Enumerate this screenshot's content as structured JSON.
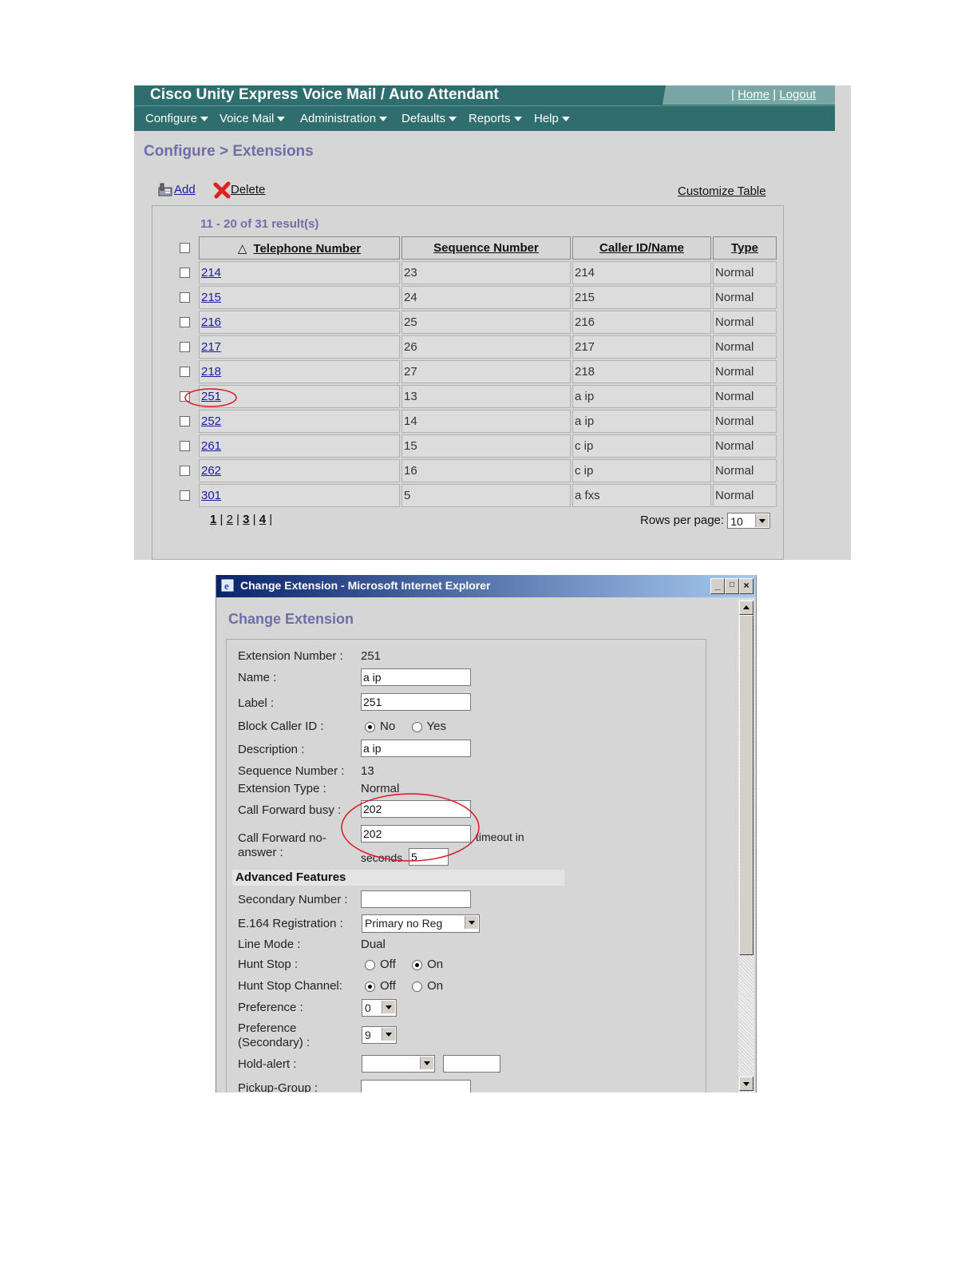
{
  "header": {
    "title": "Cisco Unity Express Voice Mail / Auto Attendant",
    "home": "Home",
    "logout": "Logout",
    "colors": {
      "bar": "#2f6e6e",
      "accent": "#7aa6a6",
      "heading": "#6e6ea8",
      "annotation": "#e0141e"
    }
  },
  "menu": [
    "Configure",
    "Voice Mail",
    "Administration",
    "Defaults",
    "Reports",
    "Help"
  ],
  "breadcrumb": "Configure > Extensions",
  "toolbar": {
    "add": "Add",
    "delete": "Delete",
    "customize": "Customize Table"
  },
  "results": "11 - 20 of 31 result(s)",
  "table": {
    "sort_indicator": "△",
    "columns": [
      "Telephone Number",
      "Sequence Number",
      "Caller ID/Name",
      "Type"
    ],
    "rows": [
      [
        "214",
        "23",
        "214",
        "Normal"
      ],
      [
        "215",
        "24",
        "215",
        "Normal"
      ],
      [
        "216",
        "25",
        "216",
        "Normal"
      ],
      [
        "217",
        "26",
        "217",
        "Normal"
      ],
      [
        "218",
        "27",
        "218",
        "Normal"
      ],
      [
        "251",
        "13",
        "a ip",
        "Normal"
      ],
      [
        "252",
        "14",
        "a ip",
        "Normal"
      ],
      [
        "261",
        "15",
        "c ip",
        "Normal"
      ],
      [
        "262",
        "16",
        "c ip",
        "Normal"
      ],
      [
        "301",
        "5",
        "a fxs",
        "Normal"
      ]
    ],
    "highlighted_row": 5
  },
  "pager": {
    "current": "1",
    "pages": [
      "2",
      "3",
      "4"
    ]
  },
  "rows_per_page": {
    "label": "Rows per page:",
    "value": "10"
  },
  "dialog": {
    "window_title": "Change Extension - Microsoft Internet Explorer",
    "heading": "Change Extension",
    "fields": {
      "extension_number": {
        "label": "Extension Number :",
        "value": "251"
      },
      "name": {
        "label": "Name :",
        "value": "a ip"
      },
      "label": {
        "label": "Label :",
        "value": "251"
      },
      "block_caller_id": {
        "label": "Block Caller ID :",
        "no": "No",
        "yes": "Yes",
        "selected": "No"
      },
      "description": {
        "label": "Description :",
        "value": "a ip"
      },
      "sequence_number": {
        "label": "Sequence Number :",
        "value": "13"
      },
      "extension_type": {
        "label": "Extension Type :",
        "value": "Normal"
      },
      "cfwd_busy": {
        "label": "Call Forward busy :",
        "value": "202"
      },
      "cfwd_noanswer": {
        "label1": "Call Forward no-",
        "label2": "answer :",
        "value": "202",
        "timeout_label": "timeout in",
        "seconds_label": "seconds",
        "seconds_value": "5"
      }
    },
    "advanced_heading": "Advanced Features",
    "advanced": {
      "secondary_number": {
        "label": "Secondary Number :",
        "value": ""
      },
      "e164": {
        "label": "E.164 Registration :",
        "value": "Primary no Reg"
      },
      "line_mode": {
        "label": "Line Mode :",
        "value": "Dual"
      },
      "hunt_stop": {
        "label": "Hunt Stop :",
        "off": "Off",
        "on": "On",
        "selected": "On"
      },
      "hunt_stop_channel": {
        "label": "Hunt Stop Channel:",
        "off": "Off",
        "on": "On",
        "selected": "Off"
      },
      "preference": {
        "label": "Preference :",
        "value": "0"
      },
      "preference_secondary": {
        "label1": "Preference",
        "label2": "(Secondary) :",
        "value": "9"
      },
      "hold_alert": {
        "label": "Hold-alert :",
        "value": ""
      },
      "pickup_group": {
        "label": "Pickup-Group :"
      }
    }
  }
}
